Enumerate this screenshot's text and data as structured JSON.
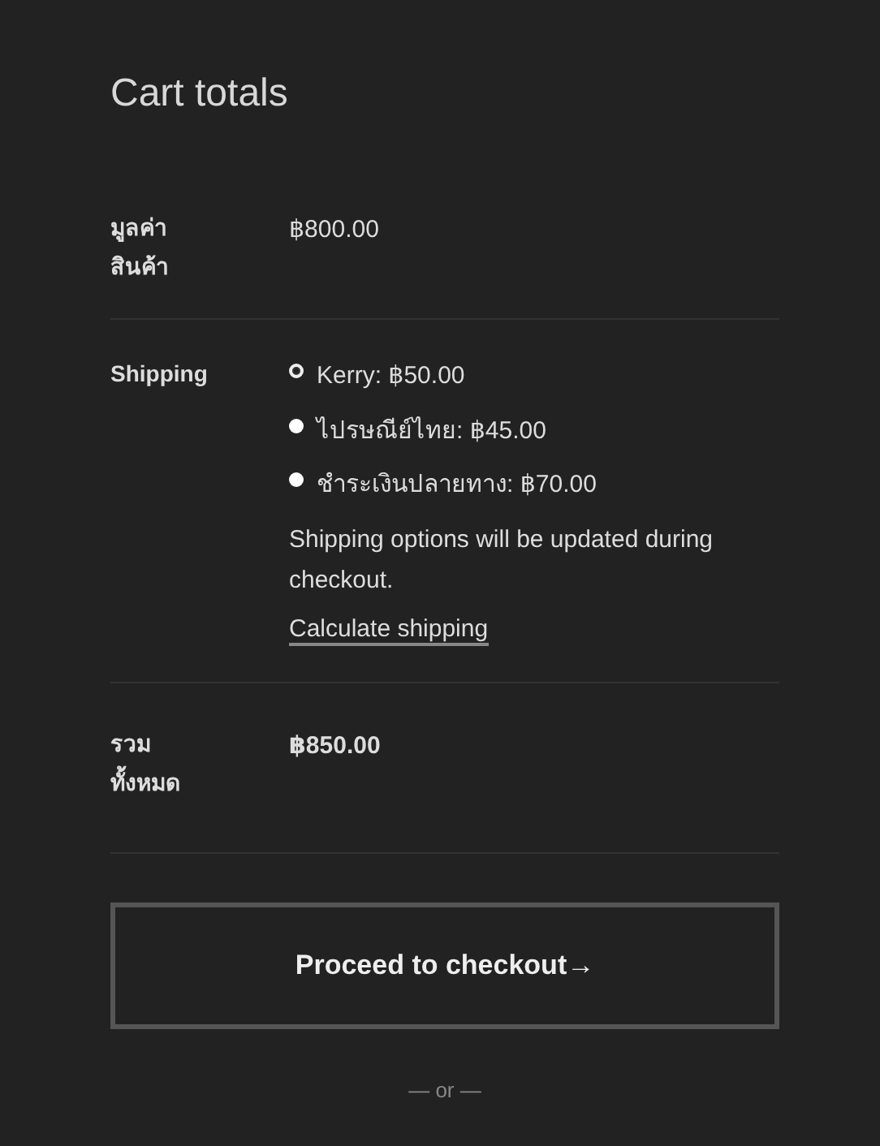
{
  "title": "Cart totals",
  "subtotal": {
    "label": "มูลค่าสินค้า",
    "value": "฿800.00"
  },
  "shipping": {
    "label": "Shipping",
    "options": [
      {
        "label": "Kerry: ฿50.00",
        "selected": true
      },
      {
        "label": "ไปรษณีย์ไทย: ฿45.00",
        "selected": false
      },
      {
        "label": "ชำระเงินปลายทาง: ฿70.00",
        "selected": false
      }
    ],
    "note": "Shipping options will be updated during checkout.",
    "link": "Calculate shipping"
  },
  "total": {
    "label": "รวมทั้งหมด",
    "value": "฿850.00"
  },
  "checkout_button": "Proceed to checkout→",
  "separator": "— or —"
}
